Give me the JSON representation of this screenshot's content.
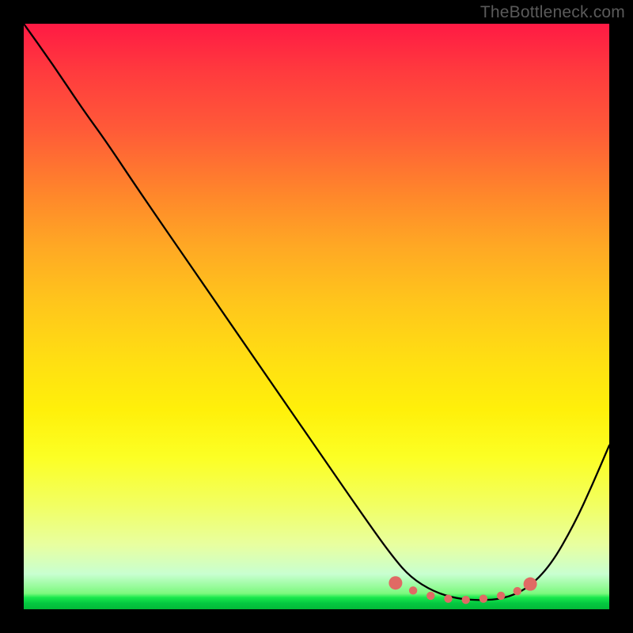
{
  "watermark": "TheBottleneck.com",
  "chart_data": {
    "type": "line",
    "title": "",
    "xlabel": "",
    "ylabel": "",
    "xlim": [
      0,
      1
    ],
    "ylim": [
      0,
      1
    ],
    "series": [
      {
        "name": "curve",
        "x": [
          0.0,
          0.05,
          0.1,
          0.14,
          0.2,
          0.3,
          0.4,
          0.5,
          0.59,
          0.63,
          0.66,
          0.7,
          0.74,
          0.78,
          0.82,
          0.86,
          0.9,
          0.94,
          0.97,
          1.0
        ],
        "y": [
          1.0,
          0.93,
          0.855,
          0.8,
          0.71,
          0.565,
          0.42,
          0.275,
          0.145,
          0.09,
          0.055,
          0.03,
          0.018,
          0.015,
          0.018,
          0.035,
          0.075,
          0.145,
          0.21,
          0.28
        ]
      }
    ],
    "markers": {
      "color": "#e06a64",
      "points": [
        {
          "x": 0.635,
          "y": 0.045
        },
        {
          "x": 0.665,
          "y": 0.032
        },
        {
          "x": 0.695,
          "y": 0.023
        },
        {
          "x": 0.725,
          "y": 0.018
        },
        {
          "x": 0.755,
          "y": 0.016
        },
        {
          "x": 0.785,
          "y": 0.018
        },
        {
          "x": 0.815,
          "y": 0.023
        },
        {
          "x": 0.843,
          "y": 0.031
        },
        {
          "x": 0.865,
          "y": 0.043
        }
      ],
      "large_indices": [
        0,
        8
      ]
    },
    "gradient_colors": {
      "top": "#ff1a44",
      "mid": "#ffe012",
      "bottom": "#03b838"
    }
  }
}
